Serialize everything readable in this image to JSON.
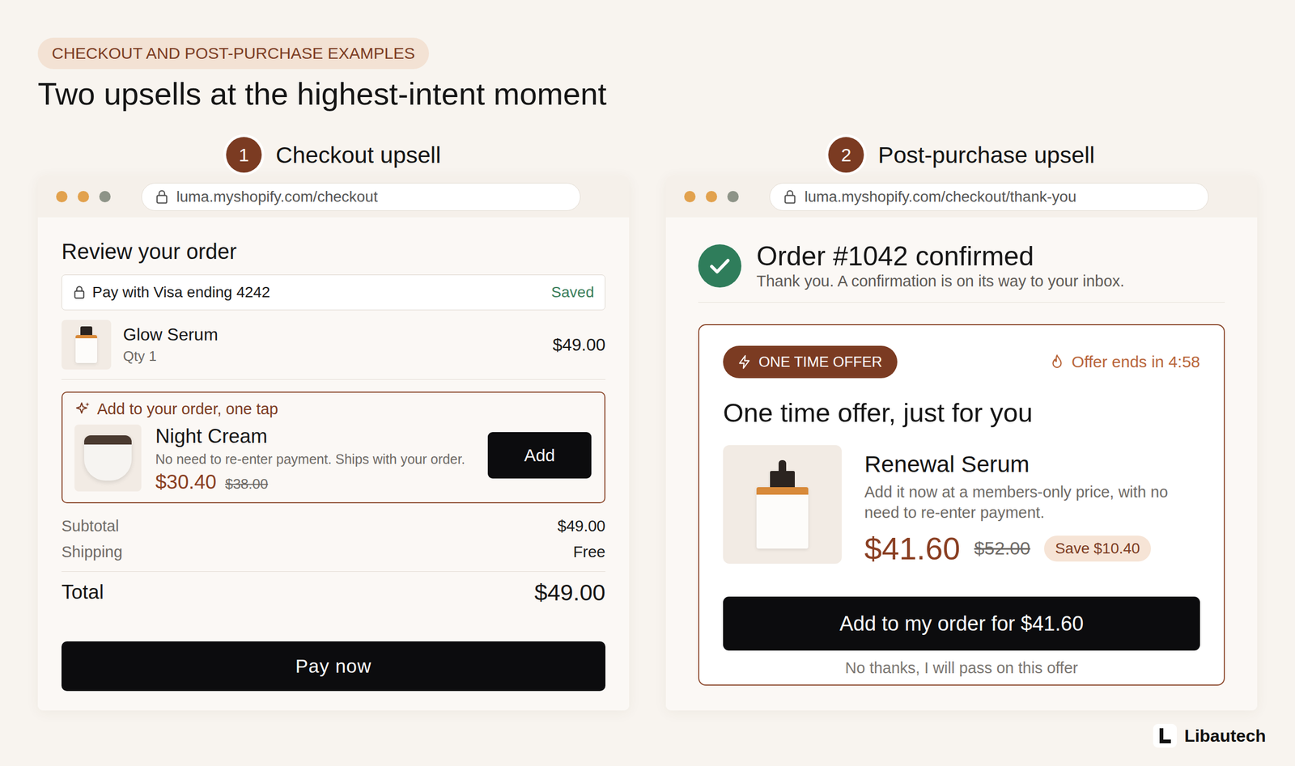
{
  "tag": "CHECKOUT AND POST-PURCHASE EXAMPLES",
  "title": "Two upsells at the highest-intent moment",
  "checkout": {
    "step": "1",
    "heading": "Checkout upsell",
    "url": "luma.myshopify.com/checkout",
    "title": "Review your order",
    "payment": {
      "label": "Pay with Visa ending 4242",
      "status": "Saved"
    },
    "items": [
      {
        "name": "Glow Serum",
        "qty": "Qty 1",
        "price": "$49.00"
      }
    ],
    "upsell": {
      "label": "Add to your order, one tap",
      "name": "Night Cream",
      "description": "No need to re-enter payment. Ships with your order.",
      "price": "$30.40",
      "original_price": "$38.00",
      "button": "Add"
    },
    "summary": [
      {
        "label": "Subtotal",
        "value": "$49.00"
      },
      {
        "label": "Shipping",
        "value": "Free"
      }
    ],
    "total": {
      "label": "Total",
      "value": "$49.00"
    },
    "button": "Pay now"
  },
  "post_purchase": {
    "step": "2",
    "heading": "Post-purchase upsell",
    "url": "luma.myshopify.com/checkout/thank-you",
    "confirmation": {
      "title": "Order #1042 confirmed",
      "subtitle": "Thank you. A confirmation is on its way to your inbox."
    },
    "offer": {
      "badge": "ONE TIME OFFER",
      "timer": "Offer ends in 4:58",
      "title": "One time offer, just for you",
      "name": "Renewal Serum",
      "description": "Add it now at a members-only price, with no need to re-enter payment.",
      "price": "$41.60",
      "original_price": "$52.00",
      "savings": "Save $10.40",
      "button": "Add to my order for $41.60",
      "decline": "No thanks, I will pass on this offer"
    }
  },
  "brand": "Libautech"
}
